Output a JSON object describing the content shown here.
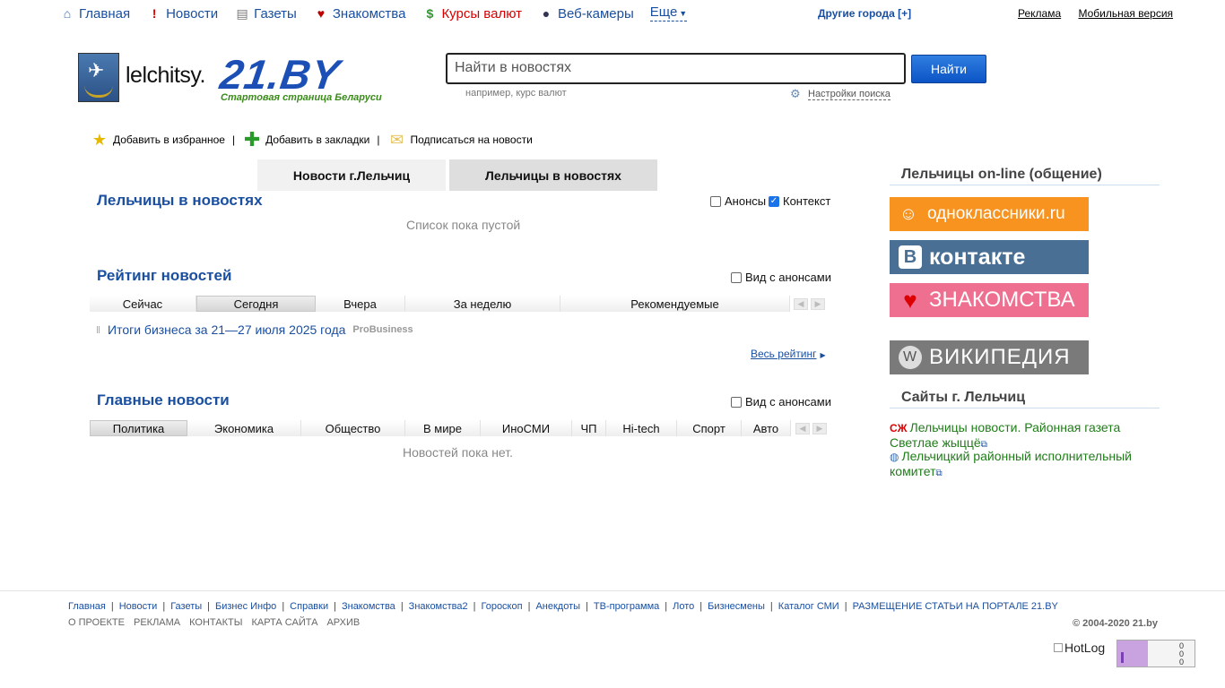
{
  "topnav": {
    "items": [
      {
        "label": "Главная",
        "icon": "home-icon"
      },
      {
        "label": "Новости",
        "icon": "exclamation-icon"
      },
      {
        "label": "Газеты",
        "icon": "newspaper-icon"
      },
      {
        "label": "Знакомства",
        "icon": "heart-icon"
      },
      {
        "label": "Курсы валют",
        "icon": "dollar-icon"
      },
      {
        "label": "Веб-камеры",
        "icon": "webcam-icon"
      }
    ],
    "more_label": "Еще",
    "other_cities": "Другие города [+]",
    "ads": "Реклама",
    "mobile": "Мобильная версия"
  },
  "header": {
    "city_logo": "lelchitsy.",
    "brand": "21.BY",
    "tagline": "Стартовая страница Беларуси"
  },
  "search": {
    "placeholder": "Найти в новостях",
    "button": "Найти",
    "hint": "например, курс валют",
    "settings": "Настройки поиска"
  },
  "actions": {
    "favorites": "Добавить в избранное",
    "bookmarks": "Добавить в закладки",
    "subscribe": "Подписаться на новости"
  },
  "main_tabs": [
    "Новости г.Лельчиц",
    "Лельчицы в новостях"
  ],
  "city_news": {
    "title": "Лельчицы в новостях",
    "announcements": "Анонсы",
    "context": "Контекст",
    "announcements_checked": false,
    "context_checked": true,
    "empty": "Список пока пустой"
  },
  "rating": {
    "title": "Рейтинг новостей",
    "with_announcements": "Вид с анонсами",
    "tabs": [
      "Сейчас",
      "Сегодня",
      "Вчера",
      "За неделю",
      "Рекомендуемые"
    ],
    "active_tab": "Сегодня",
    "items": [
      {
        "title": "Итоги бизнеса за 21—27 июля 2025 года",
        "source": "ProBusiness"
      }
    ],
    "all_link": "Весь рейтинг"
  },
  "main_news": {
    "title": "Главные новости",
    "with_announcements": "Вид с анонсами",
    "tabs": [
      "Политика",
      "Экономика",
      "Общество",
      "В мире",
      "ИноСМИ",
      "ЧП",
      "Hi-tech",
      "Спорт",
      "Авто"
    ],
    "active_tab": "Политика",
    "empty": "Новостей пока нет."
  },
  "sidebar": {
    "online_title": "Лельчицы on-line (общение)",
    "banners": [
      {
        "label": "одноклассники.ru",
        "color": "#f7931e"
      },
      {
        "label": "контакте",
        "color": "#4a6f95"
      },
      {
        "label": "ЗНАКОМСТВА",
        "color": "#ee6f8f"
      },
      {
        "label": "ВИКИПЕДИЯ",
        "color": "#7a7a7a"
      }
    ],
    "sites_title": "Сайты г. Лельчиц",
    "sites": [
      {
        "label": "Лельчицы новости. Районная газета Светлае жыццё",
        "icon": "СЖ"
      },
      {
        "label": "Лельчицкий районный исполнительный комитет",
        "icon": "globe-icon"
      }
    ]
  },
  "footer": {
    "links": [
      "Главная",
      "Новости",
      "Газеты",
      "Бизнес Инфо",
      "Справки",
      "Знакомства",
      "Знакомства2",
      "Гороскоп",
      "Анекдоты",
      "ТВ-программа",
      "Лото",
      "Бизнесмены",
      "Каталог СМИ",
      "РАЗМЕЩЕНИЕ СТАТЬИ НА ПОРТАЛЕ 21.BY"
    ],
    "links2": [
      "О ПРОЕКТЕ",
      "РЕКЛАМА",
      "КОНТАКТЫ",
      "КАРТА САЙТА",
      "АРХИВ"
    ],
    "copyright": "© 2004-2020 21.by",
    "hotlog": "HotLog",
    "counter": [
      "0",
      "0",
      "0"
    ]
  }
}
